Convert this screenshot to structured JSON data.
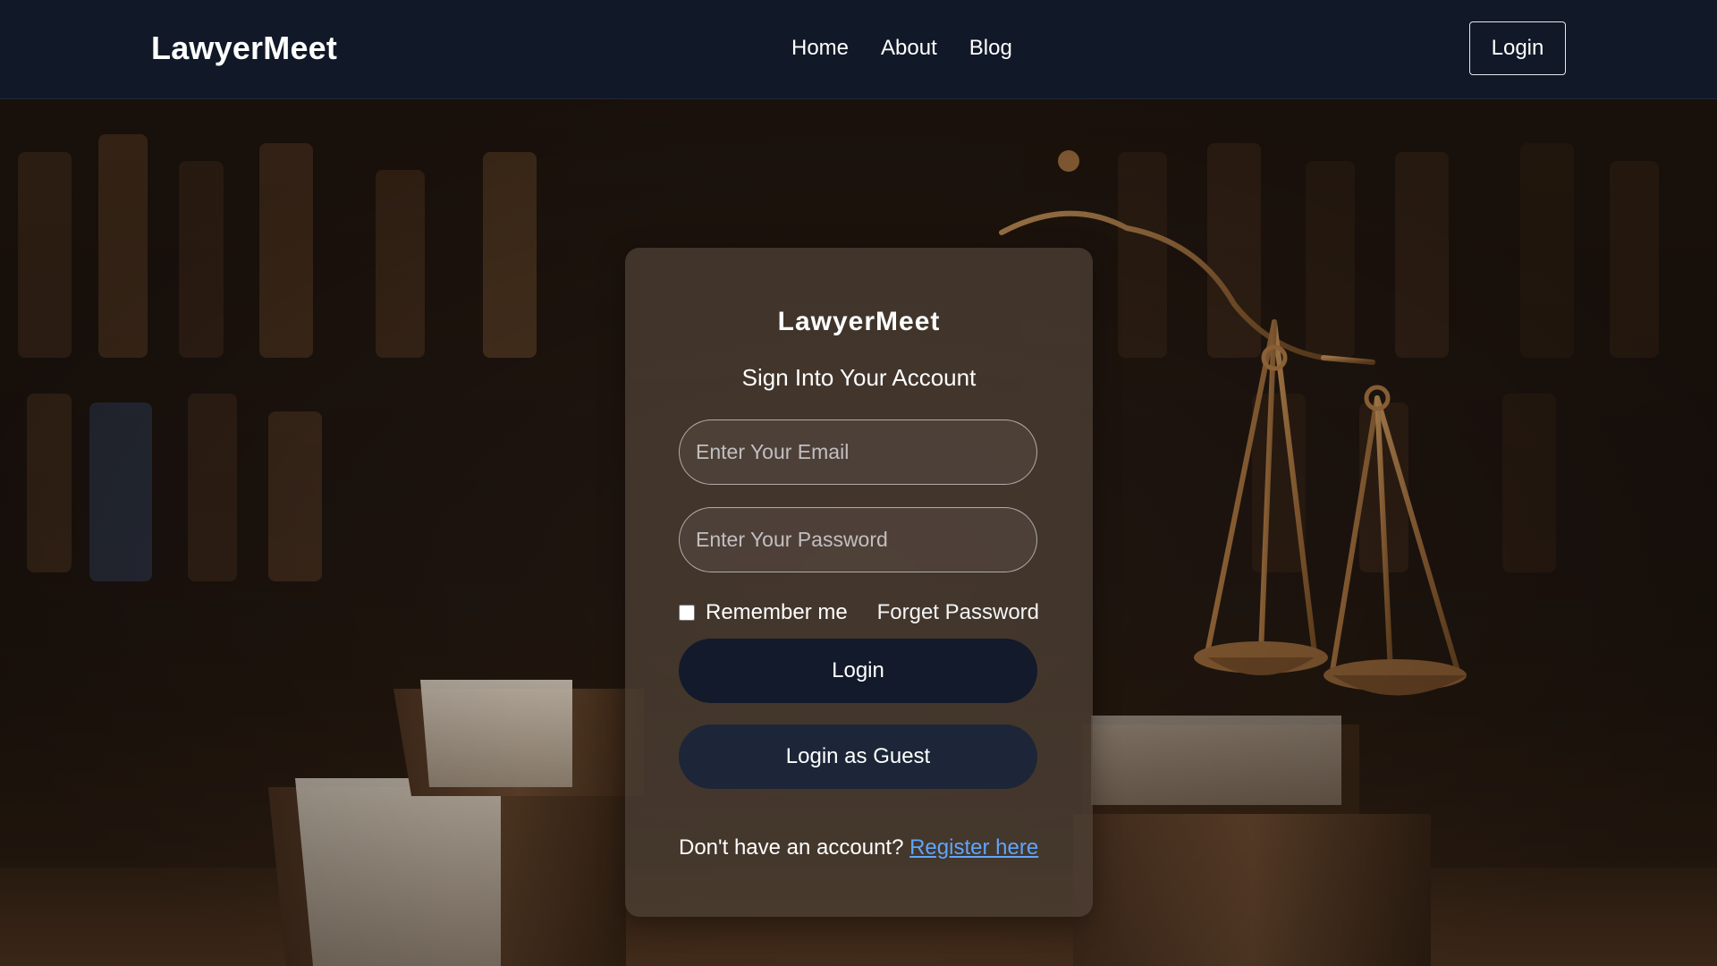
{
  "navbar": {
    "brand": "LawyerMeet",
    "links": [
      {
        "label": "Home"
      },
      {
        "label": "About"
      },
      {
        "label": "Blog"
      }
    ],
    "login_label": "Login"
  },
  "card": {
    "title": "LawyerMeet",
    "subtitle": "Sign Into Your Account",
    "email": {
      "placeholder": "Enter Your Email",
      "value": ""
    },
    "password": {
      "placeholder": "Enter Your Password",
      "value": ""
    },
    "remember_label": "Remember me",
    "remember_checked": false,
    "forget_label": "Forget Password",
    "login_button": "Login",
    "guest_button": "Login as Guest",
    "register_prompt": "Don't have an account?",
    "register_link": "Register here"
  },
  "colors": {
    "navbar_bg": "#111827",
    "button_primary": "#121a2b",
    "button_secondary": "#1c2638",
    "link": "#60a5fa"
  },
  "background": {
    "image_subject": "scales of justice and law books in a library"
  }
}
